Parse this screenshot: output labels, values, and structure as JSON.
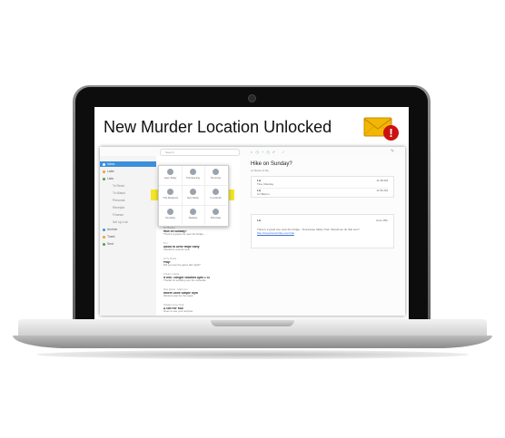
{
  "headline": "New Murder Location Unlocked",
  "alert_glyph": "!",
  "colors": {
    "accent": "#3d8fdc",
    "envelope": "#f2b705",
    "alert": "#cc1111",
    "highlight": "#f3e52b"
  },
  "mail": {
    "search_placeholder": "Search",
    "subject": "Hike on Sunday?",
    "subject_meta": "Liz Barton & Me",
    "sidebar": [
      {
        "label": "Inbox",
        "selected": true
      },
      {
        "label": "Later",
        "selected": false
      },
      {
        "label": "Lists",
        "selected": false
      },
      {
        "label": "To Read",
        "sub": true
      },
      {
        "label": "To Watch",
        "sub": true
      },
      {
        "label": "Personal",
        "sub": true
      },
      {
        "label": "Receipts",
        "sub": true
      },
      {
        "label": "Finance",
        "sub": true
      },
      {
        "label": "Set Up List",
        "sub": true
      },
      {
        "label": "Archive",
        "selected": false
      },
      {
        "label": "Trash",
        "selected": false
      },
      {
        "label": "Sent",
        "selected": false
      }
    ],
    "snooze_options": [
      {
        "label": "Later Today"
      },
      {
        "label": "This Evening"
      },
      {
        "label": "Tomorrow"
      },
      {
        "label": "This Weekend"
      },
      {
        "label": "Next Week"
      },
      {
        "label": "In a Month"
      },
      {
        "label": "Someday"
      },
      {
        "label": "Desktop"
      },
      {
        "label": "Pick Date"
      }
    ],
    "messages": [
      {
        "from": "Liz Barton",
        "subject": "Hike on Sunday?",
        "preview": "There's a great one near the bridge..."
      },
      {
        "from": "Tim",
        "subject": "About to Drive Hope Early",
        "preview": "Should be around noon"
      },
      {
        "from": "Lizzy Davis",
        "subject": "Play!",
        "preview": "Did you see the game last night?"
      },
      {
        "from": "Kristen Castle",
        "subject": "RTEB: Tonight Volumes April 1 ST",
        "preview": "Thanks for sending over the schedule"
      },
      {
        "from": "Dan Davis - Mail.com",
        "subject": "Where Done Simple Gym",
        "preview": "Workout plan for the week"
      },
      {
        "from": "Natalie Greer Pak",
        "subject": "A Gift For You!",
        "preview": "Open to see your surprise"
      }
    ],
    "thread": [
      {
        "from": "Liz",
        "to": "Tina, Monday",
        "time": "11:48 AM"
      },
      {
        "from": "Liz",
        "to": "Liz Barton",
        "time": "11:50 AM"
      }
    ],
    "reply": {
      "from": "Liz",
      "time": "June 26th",
      "body": "There's a great one near the bridge - Tennessee Valley Trail. Should we do that one?",
      "link": "http://www.bartonhike.com/trail"
    }
  }
}
